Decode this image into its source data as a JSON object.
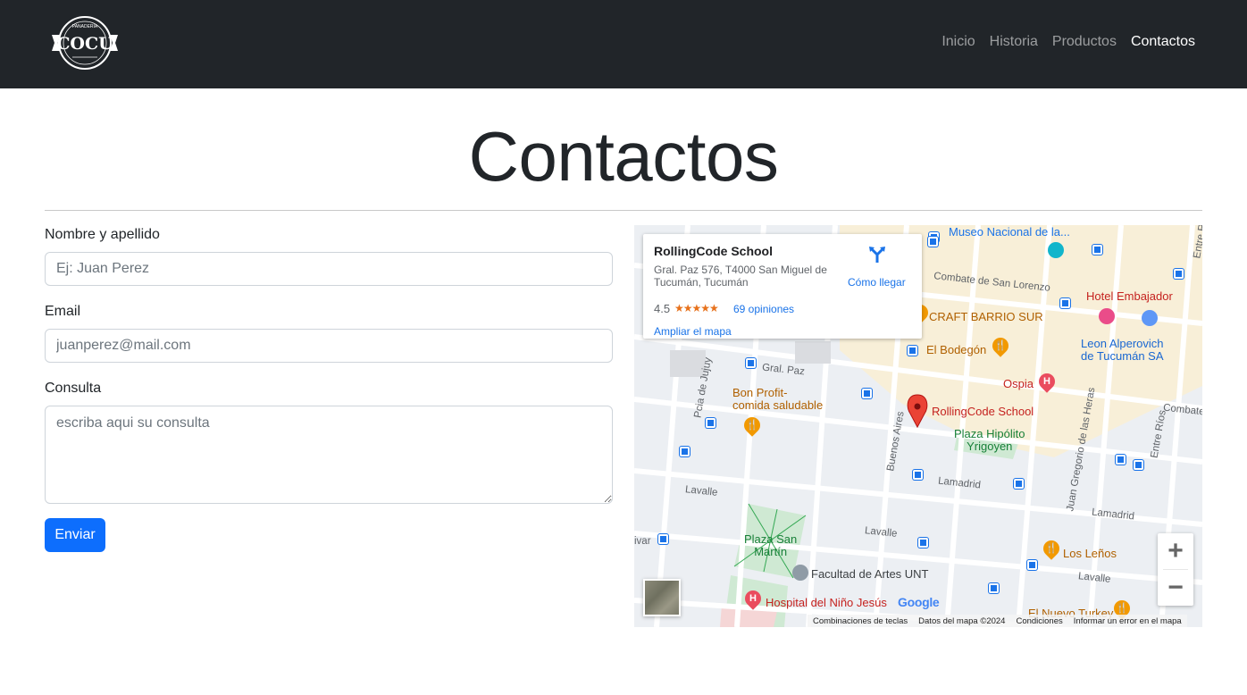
{
  "nav": {
    "logo_text": "COCU",
    "logo_ring_text": "PANADERIA",
    "links": [
      "Inicio",
      "Historia",
      "Productos",
      "Contactos"
    ]
  },
  "page": {
    "title": "Contactos"
  },
  "form": {
    "name_label": "Nombre y apellido",
    "name_placeholder": "Ej: Juan Perez",
    "email_label": "Email",
    "email_placeholder": "juanperez@mail.com",
    "query_label": "Consulta",
    "query_placeholder": "escriba aqui su consulta",
    "submit_label": "Enviar"
  },
  "map": {
    "card": {
      "name": "RollingCode School",
      "address": "Gral. Paz 576, T4000 San Miguel de Tucumán, Tucumán",
      "rating": "4.5",
      "stars": "★★★★★",
      "reviews": "69 opiniones",
      "enlarge": "Ampliar el mapa",
      "directions": "Cómo llegar"
    },
    "places": {
      "museo": "Museo Nacional de la...",
      "hotel": "Hotel Embajador",
      "craft": "CRAFT BARRIO SUR",
      "bodegon": "El Bodegón",
      "leon1": "Leon Alperovich",
      "leon2": "de Tucumán SA",
      "ospia": "Ospia",
      "bon1": "Bon Profit-",
      "bon2": "comida saludable",
      "rolling": "RollingCode School",
      "plaza_hy1": "Plaza Hipólito",
      "plaza_hy2": "Yrigoyen",
      "plaza_sm1": "Plaza San",
      "plaza_sm2": "Martín",
      "facultad": "Facultad de Artes UNT",
      "hospital": "Hospital del Niño Jesús",
      "lenos": "Los Leños",
      "turkey": "El Nuevo Turkey"
    },
    "streets": {
      "lorenzo": "Combate de San Lorenzo",
      "gralpaz": "Gral. Paz",
      "jujuy": "Pcia de Jujuy",
      "baires": "Buenos Aires",
      "lamadrid1": "Lamadrid",
      "lamadrid2": "Lamadrid",
      "lavalle1": "Lavalle",
      "lavalle2": "Lavalle",
      "lavalle3": "Lavalle",
      "jgheras": "Juan Gregorio de las Heras",
      "entrerios1": "Entre Ríos",
      "entrerios2": "Entre R",
      "combate2": "Combate",
      "rivar": "ivar"
    },
    "zoom_in": "+",
    "zoom_out": "−",
    "google": "Google",
    "footer": [
      "Combinaciones de teclas",
      "Datos del mapa ©2024",
      "Condiciones",
      "Informar un error en el mapa"
    ]
  }
}
